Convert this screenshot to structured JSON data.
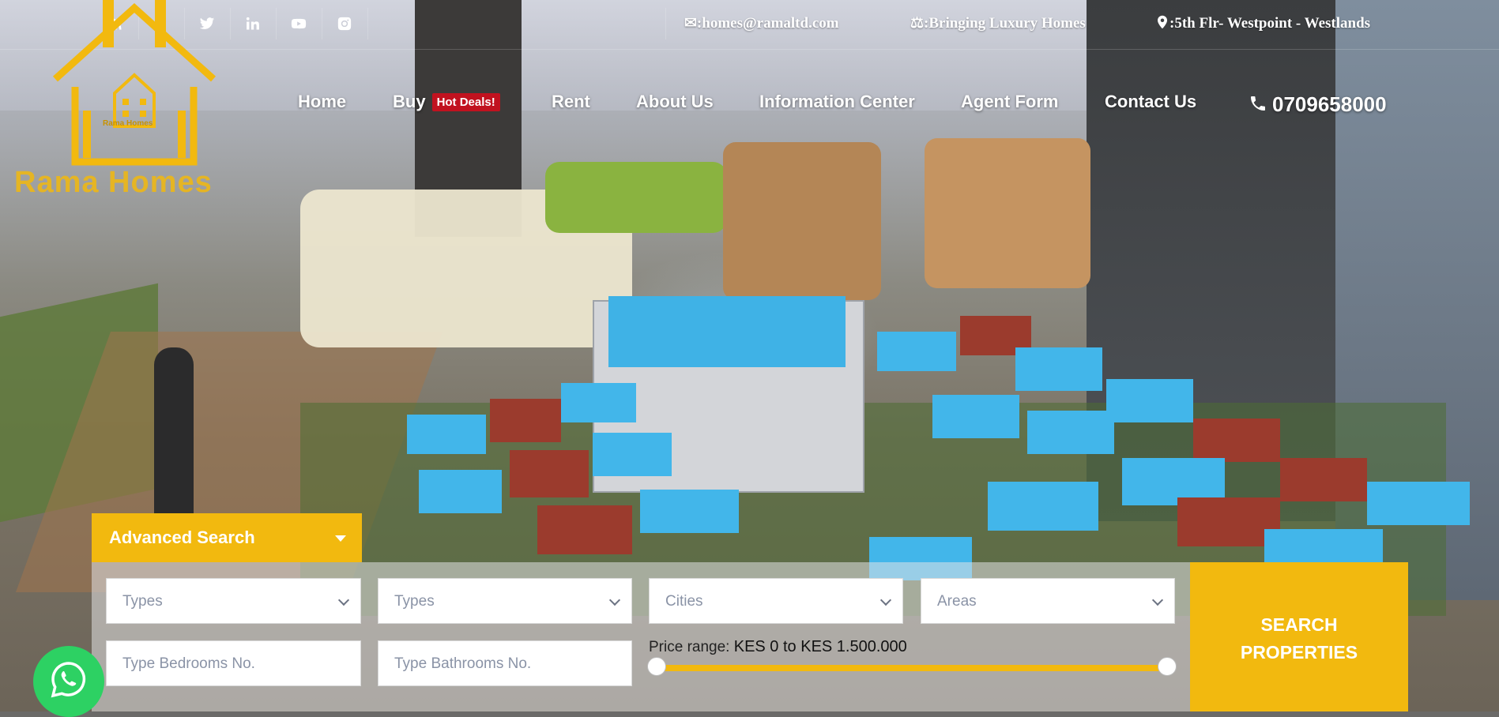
{
  "social": {
    "icons": [
      "rss-icon",
      "facebook-icon",
      "twitter-icon",
      "linkedin-icon",
      "youtube-icon",
      "instagram-icon"
    ]
  },
  "contact": {
    "email": "✉:homes@ramaltd.com",
    "tagline": "⚖:Bringing Luxury Homes",
    "address": ":5th Flr- Westpoint - Westlands"
  },
  "logo": {
    "small_text": "Rama Homes",
    "brand": "Rama Homes"
  },
  "nav": {
    "home": "Home",
    "buy": "Buy",
    "hot_badge": "Hot Deals!",
    "rent": "Rent",
    "about": "About Us",
    "info": "Information Center",
    "agent": "Agent Form",
    "contact": "Contact Us"
  },
  "phone": "0709658000",
  "advanced_search": {
    "title": "Advanced Search",
    "type_1": "Types",
    "type_2": "Types",
    "cities": "Cities",
    "areas": "Areas",
    "bedrooms_placeholder": "Type Bedrooms No.",
    "bathrooms_placeholder": "Type Bathrooms No.",
    "price_label": "Price range:",
    "price_value": "KES 0 to KES 1.500.000",
    "search_button_line1": "SEARCH",
    "search_button_line2": "PROPERTIES"
  },
  "colors": {
    "accent": "#f2b90f",
    "hot": "#c1121f",
    "whatsapp": "#2dd163"
  }
}
